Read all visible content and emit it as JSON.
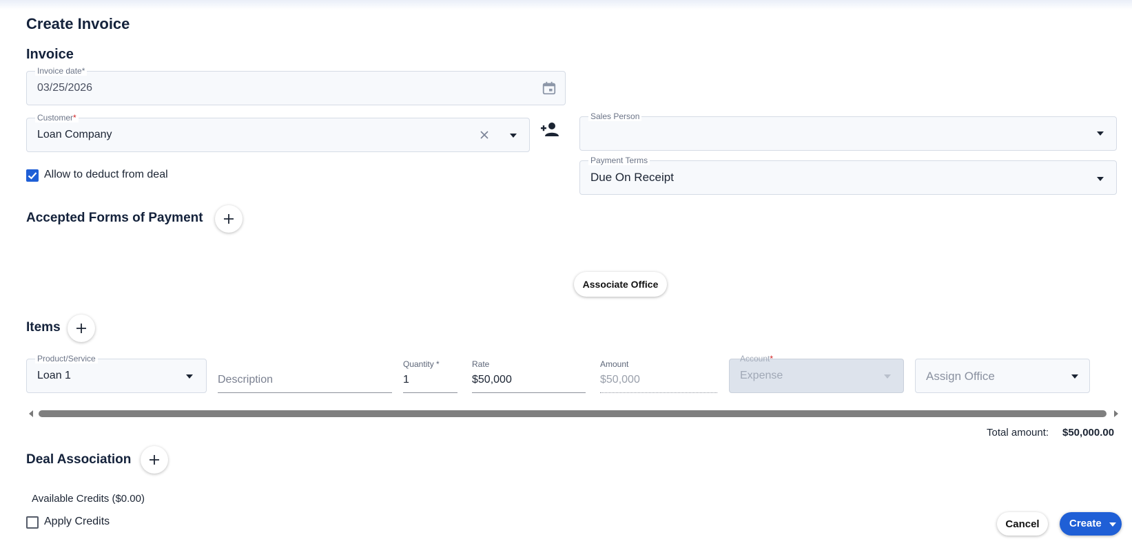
{
  "page": {
    "title": "Create Invoice",
    "section_title": "Invoice"
  },
  "invoice_date": {
    "label": "Invoice date",
    "required_mark": "*",
    "value": "03/25/2026"
  },
  "customer": {
    "label": "Customer",
    "required_mark": "*",
    "value": "Loan Company"
  },
  "sales_person": {
    "label": "Sales Person",
    "value": ""
  },
  "payment_terms": {
    "label": "Payment Terms",
    "value": "Due On Receipt"
  },
  "allow_deduct": {
    "label": "Allow to deduct from deal",
    "checked": true
  },
  "accepted_forms": {
    "title": "Accepted Forms of Payment"
  },
  "associate_office": {
    "label": "Associate Office"
  },
  "items": {
    "title": "Items",
    "product_label": "Product/Service",
    "product_value": "Loan 1",
    "description_placeholder": "Description",
    "quantity_label": "Quantity *",
    "quantity_value": "1",
    "rate_label": "Rate",
    "rate_value": "$50,000",
    "amount_label": "Amount",
    "amount_value": "$50,000",
    "account_label": "Account",
    "account_required_mark": "*",
    "account_value": "Expense",
    "assign_office_placeholder": "Assign Office"
  },
  "total": {
    "label": "Total amount:",
    "value": "$50,000.00"
  },
  "deal_association": {
    "title": "Deal Association"
  },
  "credits": {
    "available": "Available Credits ($0.00)",
    "apply_label": "Apply Credits",
    "apply_checked": false
  },
  "footer": {
    "cancel_label": "Cancel",
    "create_label": "Create"
  },
  "colors": {
    "primary": "#1f5fd6",
    "heading": "#14223b",
    "required": "#d02020"
  }
}
